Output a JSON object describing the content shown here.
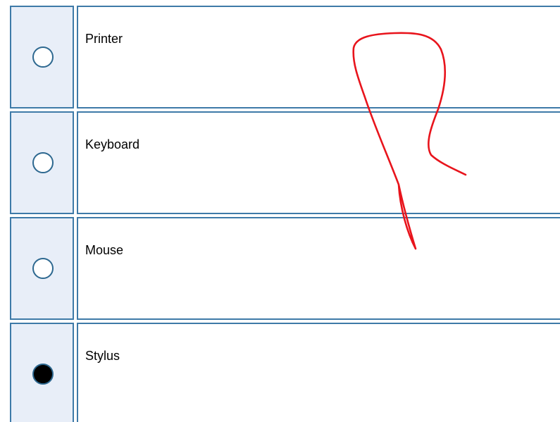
{
  "options": [
    {
      "label": "Printer",
      "selected": false
    },
    {
      "label": "Keyboard",
      "selected": false
    },
    {
      "label": "Mouse",
      "selected": false
    },
    {
      "label": "Stylus",
      "selected": true
    }
  ],
  "colors": {
    "border": "#3e7aa8",
    "radio_cell_bg": "#e8eef8",
    "radio_border": "#2d6890",
    "ink_stroke": "#e8141c"
  }
}
